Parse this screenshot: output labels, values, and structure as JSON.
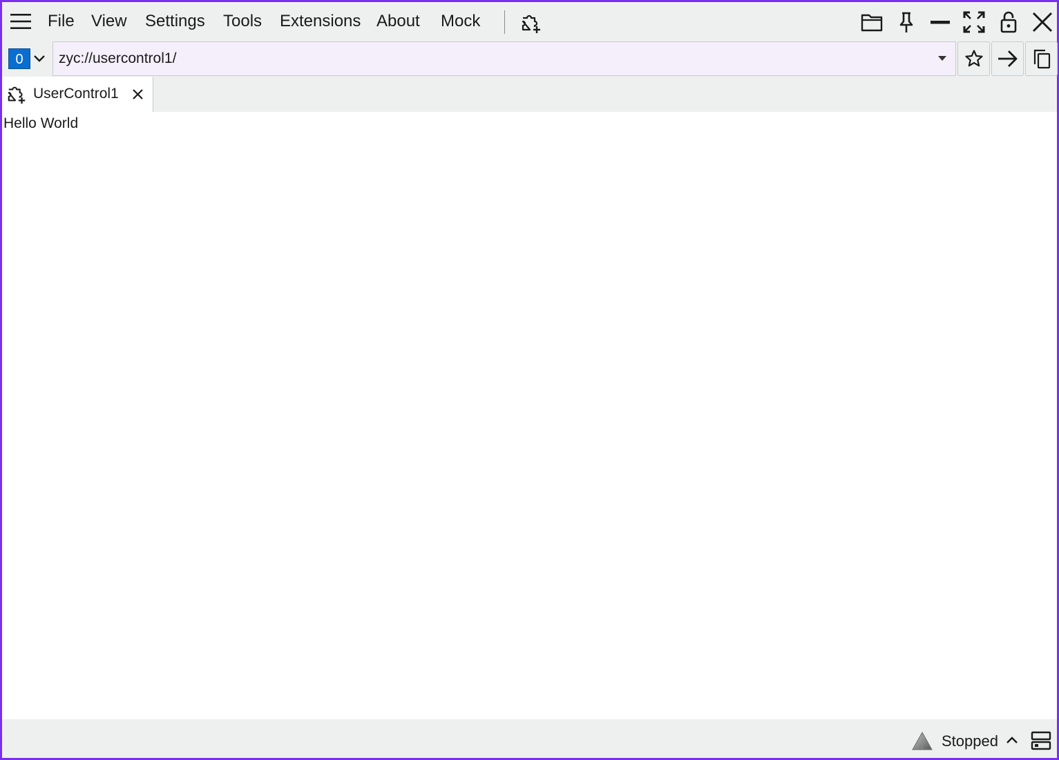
{
  "menubar": {
    "hamburger_icon": "hamburger-menu-icon",
    "items": [
      {
        "label": "File"
      },
      {
        "label": "View"
      },
      {
        "label": "Settings"
      },
      {
        "label": "Tools"
      },
      {
        "label": "Extensions"
      },
      {
        "label": "About"
      },
      {
        "label": "Mock"
      }
    ],
    "extension_icon": "puzzle-plus-icon",
    "window_buttons": [
      "folder-icon",
      "pin-icon",
      "minimize-icon",
      "maximize-icon",
      "lock-icon",
      "close-icon"
    ]
  },
  "addressbar": {
    "tab_count": "0",
    "url": "zyc://usercontrol1/",
    "buttons": [
      "star-icon",
      "go-arrow-icon",
      "copy-icon"
    ]
  },
  "tabs": [
    {
      "label": "UserControl1",
      "icon": "puzzle-plus-icon",
      "active": true
    }
  ],
  "content": {
    "text": "Hello World"
  },
  "statusbar": {
    "status": "Stopped",
    "status_icon": "triangle-icon",
    "panel_icon": "panel-layout-icon"
  },
  "colors": {
    "window_border": "#7a2ff0",
    "chrome_bg": "#eef0f0",
    "url_bg": "#f5effc",
    "tab_count_bg": "#0a6ed1"
  }
}
